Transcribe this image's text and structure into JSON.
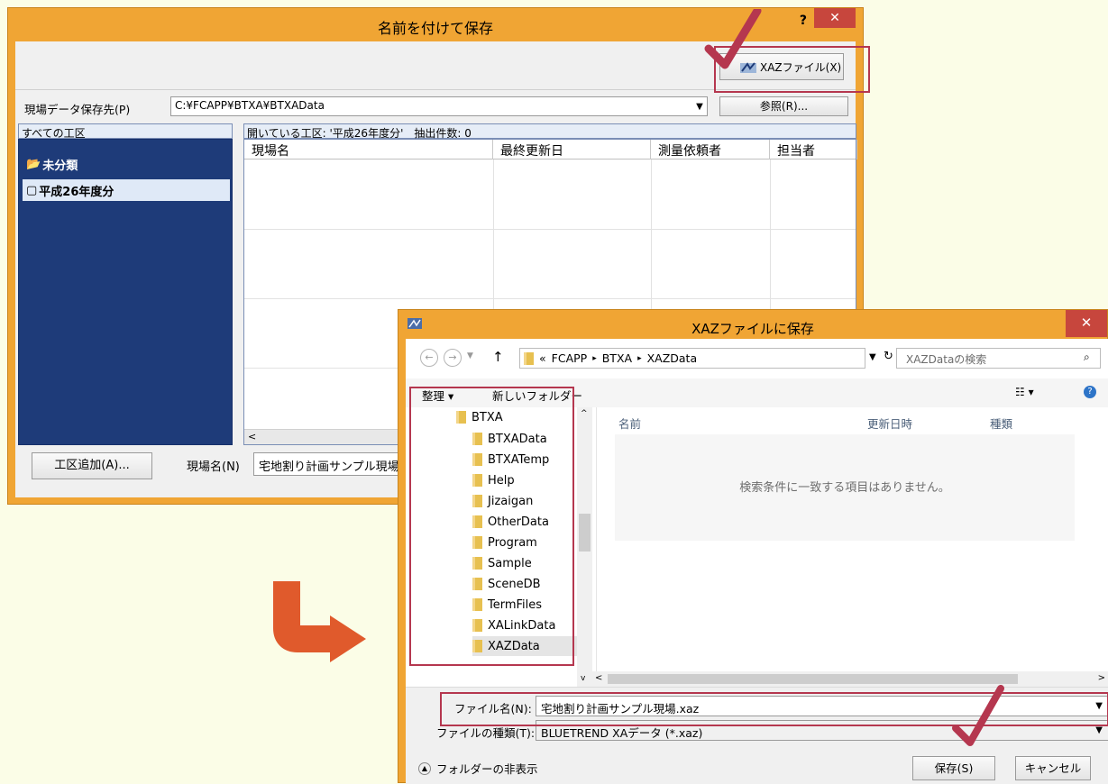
{
  "dialog1": {
    "title": "名前を付けて保存",
    "help": "?",
    "close": "✕",
    "xaz_button": "XAZファイル(X)",
    "path_label": "現場データ保存先(P)",
    "path_value": "C:¥FCAPP¥BTXA¥BTXAData",
    "browse_button": "参照(R)...",
    "all_sections": "すべての工区",
    "open_section_info": "開いている工区: '平成26年度分'　抽出件数: 0",
    "tree": [
      "未分類",
      "平成26年度分"
    ],
    "columns": [
      "現場名",
      "最終更新日",
      "測量依頼者",
      "担当者"
    ],
    "add_section_button": "工区追加(A)...",
    "site_name_label": "現場名(N)",
    "site_name_value": "宅地割り計画サンプル現場"
  },
  "dialog2": {
    "title": "XAZファイルに保存",
    "close": "✕",
    "breadcrumb": [
      "«",
      "FCAPP",
      "BTXA",
      "XAZData"
    ],
    "search_placeholder": "XAZDataの検索",
    "organize": "整理 ▾",
    "new_folder": "新しいフォルダー",
    "root_folder": "BTXA",
    "folders": [
      "BTXAData",
      "BTXATemp",
      "Help",
      "Jizaigan",
      "OtherData",
      "Program",
      "Sample",
      "SceneDB",
      "TermFiles",
      "XALinkData",
      "XAZData"
    ],
    "list_columns": [
      "名前",
      "更新日時",
      "種類"
    ],
    "empty_message": "検索条件に一致する項目はありません。",
    "filename_label": "ファイル名(N):",
    "filename_value": "宅地割り計画サンプル現場.xaz",
    "filetype_label": "ファイルの種類(T):",
    "filetype_value": "BLUETREND XAデータ (*.xaz)",
    "hide_folders": "フォルダーの非表示",
    "save_button": "保存(S)",
    "cancel_button": "キャンセル"
  },
  "colors": {
    "window_frame": "#f0a534",
    "highlight": "#b5374f",
    "arrow": "#e05a2c",
    "tree_bg": "#1e3b79"
  }
}
